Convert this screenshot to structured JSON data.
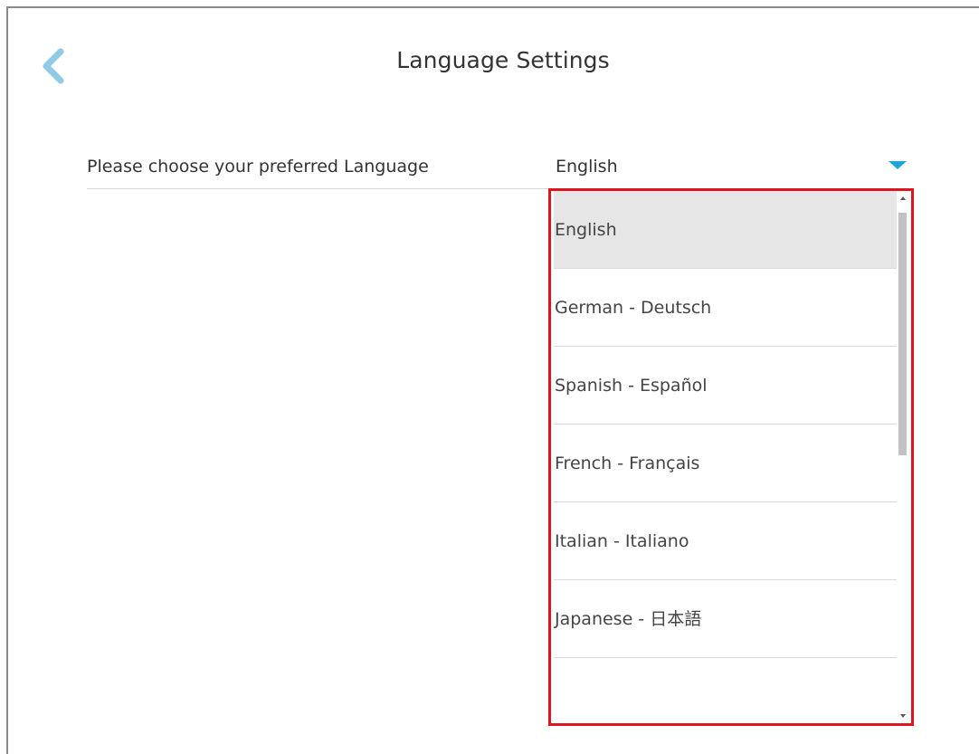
{
  "header": {
    "title": "Language Settings",
    "back_icon": "chevron-left-icon",
    "accent_color": "#1ba6dd"
  },
  "setting": {
    "label": "Please choose your preferred Language",
    "selected_value": "English",
    "dropdown_icon": "caret-down-icon"
  },
  "dropdown": {
    "highlight_color": "#e0141c",
    "options": [
      {
        "label": "English",
        "selected": true
      },
      {
        "label": "German - Deutsch",
        "selected": false
      },
      {
        "label": "Spanish - Español",
        "selected": false
      },
      {
        "label": "French - Français",
        "selected": false
      },
      {
        "label": "Italian - Italiano",
        "selected": false
      },
      {
        "label": "Japanese - 日本語",
        "selected": false
      },
      {
        "label": "",
        "selected": false
      }
    ],
    "scroll_position": 0
  }
}
